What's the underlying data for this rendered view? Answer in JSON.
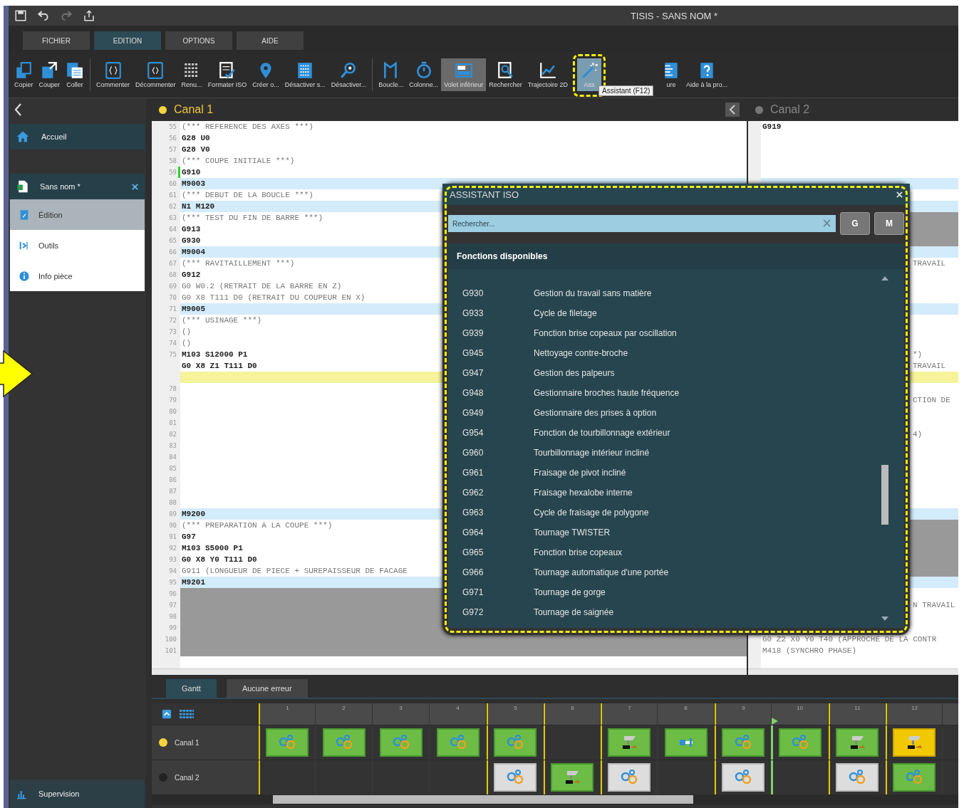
{
  "title_bar": {
    "title": "TISIS - SANS NOM *",
    "quick_actions": [
      {
        "disabled": false
      },
      {
        "disabled": false
      },
      {
        "disabled": true
      },
      {
        "disabled": false
      }
    ]
  },
  "menu_tabs": [
    {
      "label": "FICHIER",
      "selected": false
    },
    {
      "label": "EDITION",
      "selected": true
    },
    {
      "label": "OPTIONS",
      "selected": false
    },
    {
      "label": "AIDE",
      "selected": false
    }
  ],
  "ribbon": {
    "groups": [
      [
        {
          "label": "Copier",
          "selected": false
        },
        {
          "label": "Couper",
          "selected": false
        },
        {
          "label": "Coller",
          "selected": false
        }
      ],
      [
        {
          "label": "Commenter",
          "selected": false
        },
        {
          "label": "Décommenter",
          "selected": false
        },
        {
          "label": "Renu...",
          "selected": false
        },
        {
          "label": "Formater ISO",
          "selected": false
        },
        {
          "label": "Créer o...",
          "selected": false
        },
        {
          "label": "Désactiver s...",
          "selected": false
        },
        {
          "label": "Désactiver...",
          "selected": false
        }
      ],
      [
        {
          "label": "Boucle...",
          "selected": false
        },
        {
          "label": "Colonne...",
          "selected": false
        },
        {
          "label": "Volet inférieur",
          "selected": true
        },
        {
          "label": "Rechercher",
          "selected": false
        },
        {
          "label": "Trajectoire 2D",
          "selected": false
        },
        {
          "label": "Ass",
          "selected": true,
          "highlighted": true
        },
        {
          "label": "ure",
          "selected": false
        },
        {
          "label": "Aide à la pro...",
          "selected": false
        }
      ]
    ],
    "tooltip": "Assistant (F12)"
  },
  "sidebar": {
    "home": {
      "label": "Accueil"
    },
    "document": {
      "label": "Sans nom *",
      "children": [
        {
          "label": "Édition",
          "selected": true
        },
        {
          "label": "Outils",
          "selected": false
        },
        {
          "label": "Info pièce",
          "selected": false
        }
      ]
    },
    "footer": {
      "label": "Supervision"
    }
  },
  "canals": [
    {
      "name": "Canal 1",
      "active": true,
      "lines": [
        {
          "number": "55",
          "text": "(*** REFERENCE DES AXES ***)",
          "comment": true,
          "kind": "plain",
          "marked": false
        },
        {
          "number": "56",
          "text": "G28 U0",
          "comment": false,
          "kind": "plain",
          "marked": false
        },
        {
          "number": "57",
          "text": "G28 V0",
          "comment": false,
          "kind": "plain",
          "marked": false
        },
        {
          "number": "58",
          "text": "(*** COUPE INITIALE ***)",
          "comment": true,
          "kind": "plain",
          "marked": false
        },
        {
          "number": "59",
          "text": "G910",
          "comment": false,
          "kind": "plain",
          "marked": true
        },
        {
          "number": "60",
          "text": "M9003",
          "comment": false,
          "kind": "highlight",
          "marked": false
        },
        {
          "number": "61",
          "text": "(*** DEBUT DE LA BOUCLE ***)",
          "comment": true,
          "kind": "plain",
          "marked": false
        },
        {
          "number": "62",
          "text": "N1 M120",
          "comment": false,
          "kind": "highlight",
          "marked": false
        },
        {
          "number": "63",
          "text": "(*** TEST DU FIN DE BARRE ***)",
          "comment": true,
          "kind": "plain",
          "marked": false
        },
        {
          "number": "64",
          "text": "G913",
          "comment": false,
          "kind": "plain",
          "marked": false
        },
        {
          "number": "65",
          "text": "G930",
          "comment": false,
          "kind": "plain",
          "marked": false
        },
        {
          "number": "66",
          "text": "M9004",
          "comment": false,
          "kind": "highlight",
          "marked": false
        },
        {
          "number": "67",
          "text": "(*** RAVITAILLEMENT ***)",
          "comment": true,
          "kind": "plain",
          "marked": false
        },
        {
          "number": "68",
          "text": "G912",
          "comment": false,
          "kind": "plain",
          "marked": false
        },
        {
          "number": "69",
          "text": "G0 W0.2 (RETRAIT DE LA BARRE EN Z)",
          "comment": true,
          "kind": "plain",
          "marked": false
        },
        {
          "number": "70",
          "text": "G0 X8 T111 D0 (RETRAIT DU COUPEUR EN X)",
          "comment": true,
          "kind": "plain",
          "marked": false
        },
        {
          "number": "71",
          "text": "M9005",
          "comment": false,
          "kind": "highlight",
          "marked": false
        },
        {
          "number": "72",
          "text": "(*** USINAGE ***)",
          "comment": true,
          "kind": "plain",
          "marked": false
        },
        {
          "number": "73",
          "text": "()",
          "comment": true,
          "kind": "plain",
          "marked": false
        },
        {
          "number": "74",
          "text": "()",
          "comment": true,
          "kind": "plain",
          "marked": false
        },
        {
          "number": "75",
          "text": "M103 S12000 P1",
          "comment": false,
          "kind": "plain",
          "marked": false
        },
        {
          "text": "G0 X8 Z1 T111 D0",
          "comment": false,
          "kind": "plain",
          "marked": false
        },
        {
          "kind": "current",
          "marked": false
        },
        {
          "number": "78",
          "kind": "plain",
          "marked": false
        },
        {
          "number": "79",
          "kind": "plain",
          "marked": false
        },
        {
          "number": "80",
          "kind": "plain",
          "marked": false
        },
        {
          "number": "81",
          "kind": "plain",
          "marked": false
        },
        {
          "number": "82",
          "kind": "plain",
          "marked": false
        },
        {
          "number": "83",
          "kind": "plain",
          "marked": false
        },
        {
          "number": "84",
          "kind": "plain",
          "marked": false
        },
        {
          "number": "85",
          "kind": "plain",
          "marked": false
        },
        {
          "number": "86",
          "kind": "plain",
          "marked": false
        },
        {
          "number": "87",
          "kind": "plain",
          "marked": false
        },
        {
          "number": "88",
          "kind": "plain",
          "marked": false
        },
        {
          "number": "89",
          "text": "M9200",
          "comment": false,
          "kind": "highlight",
          "marked": false
        },
        {
          "number": "90",
          "text": "(*** PREPARATION A LA COUPE ***)",
          "comment": true,
          "kind": "plain",
          "marked": false
        },
        {
          "number": "91",
          "text": "G97",
          "comment": false,
          "kind": "plain",
          "marked": false
        },
        {
          "number": "92",
          "text": "M103 S5000 P1",
          "comment": false,
          "kind": "plain",
          "marked": false
        },
        {
          "number": "93",
          "text": "G0 X8 Y0 T111 D0",
          "comment": false,
          "kind": "plain",
          "marked": false
        },
        {
          "number": "94",
          "text": "G911 (LONGUEUR DE PIECE + SUREPAISSEUR DE FACAGE",
          "comment": true,
          "kind": "plain",
          "marked": false
        },
        {
          "number": "95",
          "text": "M9201",
          "comment": false,
          "kind": "highlight",
          "marked": false
        },
        {
          "number": "96",
          "kind": "inactive",
          "marked": false
        },
        {
          "number": "97",
          "kind": "inactive",
          "marked": false
        },
        {
          "number": "98",
          "kind": "inactive",
          "marked": false
        },
        {
          "number": "99",
          "kind": "inactive",
          "marked": false
        },
        {
          "number": "100",
          "kind": "inactive",
          "marked": false
        },
        {
          "number": "101",
          "kind": "inactive",
          "marked": false
        }
      ]
    },
    {
      "name": "Canal 2",
      "active": false,
      "lines": [
        {
          "text": "G919",
          "comment": false,
          "kind": "plain"
        },
        {
          "kind": "plain"
        },
        {
          "kind": "plain"
        },
        {
          "kind": "plain"
        },
        {
          "kind": "plain"
        },
        {
          "kind": "highlight"
        },
        {
          "kind": "plain"
        },
        {
          "kind": "highlight"
        },
        {
          "kind": "inactive"
        },
        {
          "kind": "inactive"
        },
        {
          "kind": "inactive"
        },
        {
          "kind": "highlight"
        },
        {
          "text": "TRAVAIL",
          "comment": true,
          "kind": "plain",
          "cut_off": true
        },
        {
          "kind": "plain"
        },
        {
          "kind": "plain"
        },
        {
          "kind": "plain"
        },
        {
          "kind": "highlight"
        },
        {
          "kind": "plain"
        },
        {
          "kind": "plain"
        },
        {
          "kind": "plain"
        },
        {
          "text": "*)",
          "comment": true,
          "kind": "plain",
          "cut_off": true
        },
        {
          "text": "TRAVAIL",
          "comment": true,
          "kind": "plain",
          "cut_off": true
        },
        {
          "kind": "current"
        },
        {
          "kind": "plain"
        },
        {
          "text": "CTION DE",
          "comment": true,
          "kind": "plain",
          "cut_off": true
        },
        {
          "kind": "plain"
        },
        {
          "kind": "plain"
        },
        {
          "text": "4)",
          "comment": true,
          "kind": "plain",
          "cut_off": true
        },
        {
          "kind": "plain"
        },
        {
          "kind": "plain"
        },
        {
          "kind": "plain"
        },
        {
          "kind": "plain"
        },
        {
          "kind": "plain"
        },
        {
          "kind": "plain"
        },
        {
          "kind": "highlight"
        },
        {
          "kind": "inactive"
        },
        {
          "kind": "inactive"
        },
        {
          "kind": "inactive"
        },
        {
          "kind": "inactive"
        },
        {
          "kind": "inactive"
        },
        {
          "kind": "highlight"
        },
        {
          "kind": "plain"
        },
        {
          "text": "N TRAVAIL",
          "comment": true,
          "kind": "plain",
          "cut_off": true
        },
        {
          "kind": "plain"
        },
        {
          "kind": "plain"
        },
        {
          "text": "G0 Z2 X0 Y0 T40 (APPROCHE DE LA CONTR",
          "comment": true,
          "kind": "plain"
        },
        {
          "text": "M418 (SYNCHRO PHASE)",
          "comment": true,
          "kind": "plain"
        }
      ]
    }
  ],
  "assistant": {
    "title": "ASSISTANT ISO",
    "search": {
      "placeholder": "Rechercher..."
    },
    "filters": [
      "G",
      "M"
    ],
    "section": "Fonctions disponibles",
    "functions": [
      {
        "code": "G930",
        "description": "Gestion du travail sans matière"
      },
      {
        "code": "G933",
        "description": "Cycle de filetage"
      },
      {
        "code": "G939",
        "description": "Fonction brise copeaux par oscillation"
      },
      {
        "code": "G945",
        "description": "Nettoyage contre-broche"
      },
      {
        "code": "G947",
        "description": "Gestion des palpeurs"
      },
      {
        "code": "G948",
        "description": "Gestionnaire broches haute fréquence"
      },
      {
        "code": "G949",
        "description": "Gestionnaire des prises à option"
      },
      {
        "code": "G954",
        "description": "Fonction de tourbillonnage extérieur"
      },
      {
        "code": "G960",
        "description": "Tourbillonnage intérieur incliné"
      },
      {
        "code": "G961",
        "description": "Fraisage de pivot incliné"
      },
      {
        "code": "G962",
        "description": "Fraisage hexalobe interne"
      },
      {
        "code": "G963",
        "description": "Cycle de fraisage de polygone"
      },
      {
        "code": "G964",
        "description": "Tournage TWISTER"
      },
      {
        "code": "G965",
        "description": "Fonction brise copeaux"
      },
      {
        "code": "G966",
        "description": "Tournage automatique d'une portée"
      },
      {
        "code": "G971",
        "description": "Tournage de gorge"
      },
      {
        "code": "G972",
        "description": "Tournage de saignée"
      }
    ]
  },
  "bottom_tabs": [
    {
      "label": "Gantt",
      "selected": true
    },
    {
      "label": "Aucune erreur",
      "selected": false
    }
  ],
  "gantt": {
    "columns": [
      {
        "label": "1",
        "sync": true,
        "playhead": false
      },
      {
        "label": "2",
        "sync": false,
        "playhead": false
      },
      {
        "label": "3",
        "sync": false,
        "playhead": false
      },
      {
        "label": "4",
        "sync": false,
        "playhead": false
      },
      {
        "label": "5",
        "sync": true,
        "playhead": false
      },
      {
        "label": "6",
        "sync": true,
        "playhead": false
      },
      {
        "label": "7",
        "sync": true,
        "playhead": false
      },
      {
        "label": "8",
        "sync": false,
        "playhead": false
      },
      {
        "label": "9",
        "sync": true,
        "playhead": false
      },
      {
        "label": "10",
        "sync": false,
        "playhead": true
      },
      {
        "label": "11",
        "sync": true,
        "playhead": false
      },
      {
        "label": "12",
        "sync": true,
        "playhead": false
      }
    ],
    "rows": [
      {
        "name": "Canal 1",
        "active": true,
        "cells": [
          {
            "kind": "gears"
          },
          {
            "kind": "gears"
          },
          {
            "kind": "gears"
          },
          {
            "kind": "gears"
          },
          {
            "kind": "gears"
          },
          {
            "kind": "empty"
          },
          {
            "kind": "tool"
          },
          {
            "kind": "pin"
          },
          {
            "kind": "gears"
          },
          {
            "kind": "gears"
          },
          {
            "kind": "tool"
          },
          {
            "kind": "tool-alert"
          }
        ]
      },
      {
        "name": "Canal 2",
        "active": false,
        "cells": [
          {
            "kind": "empty"
          },
          {
            "kind": "empty"
          },
          {
            "kind": "empty"
          },
          {
            "kind": "empty"
          },
          {
            "kind": "gears-idle"
          },
          {
            "kind": "tool"
          },
          {
            "kind": "gears-idle"
          },
          {
            "kind": "empty"
          },
          {
            "kind": "gears-idle"
          },
          {
            "kind": "empty"
          },
          {
            "kind": "gears-idle"
          },
          {
            "kind": "gears"
          }
        ]
      }
    ]
  }
}
